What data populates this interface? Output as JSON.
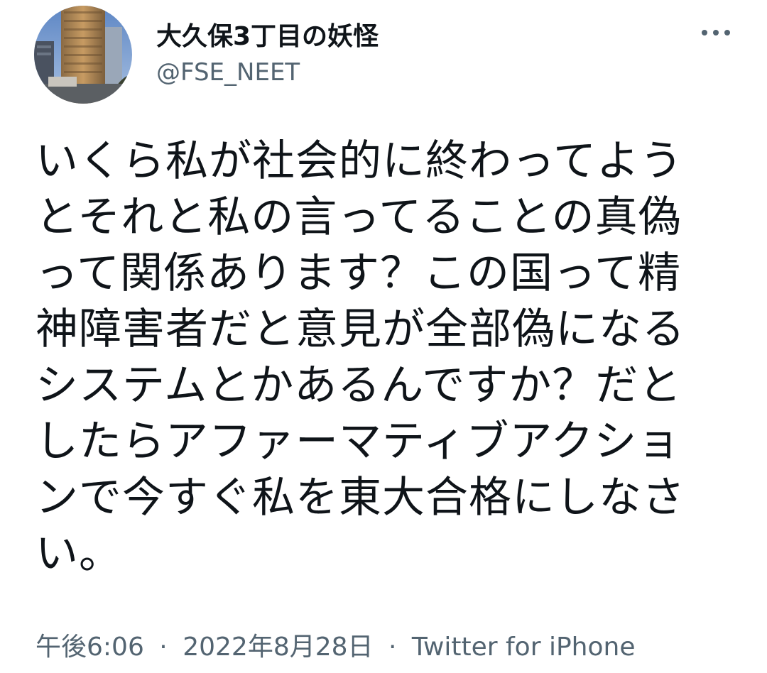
{
  "author": {
    "display_name": "大久保3丁目の妖怪",
    "handle": "@FSE_NEET",
    "avatar_alt": "profile photo of a tall building"
  },
  "tweet": {
    "text": "いくら私が社会的に終わってようとそれと私の言ってることの真偽って関係あります？この国って精神障害者だと意見が全部偽になるシステムとかあるんですか？だとしたらアファーマティブアクションで今すぐ私を東大合格にしなさい。"
  },
  "meta": {
    "time": "午後6:06",
    "separator": "·",
    "date": "2022年8月28日",
    "source": "Twitter for iPhone"
  },
  "icons": {
    "more": "more-horizontal-icon"
  },
  "colors": {
    "text_primary": "#0f1419",
    "text_secondary": "#536471",
    "background": "#ffffff"
  }
}
